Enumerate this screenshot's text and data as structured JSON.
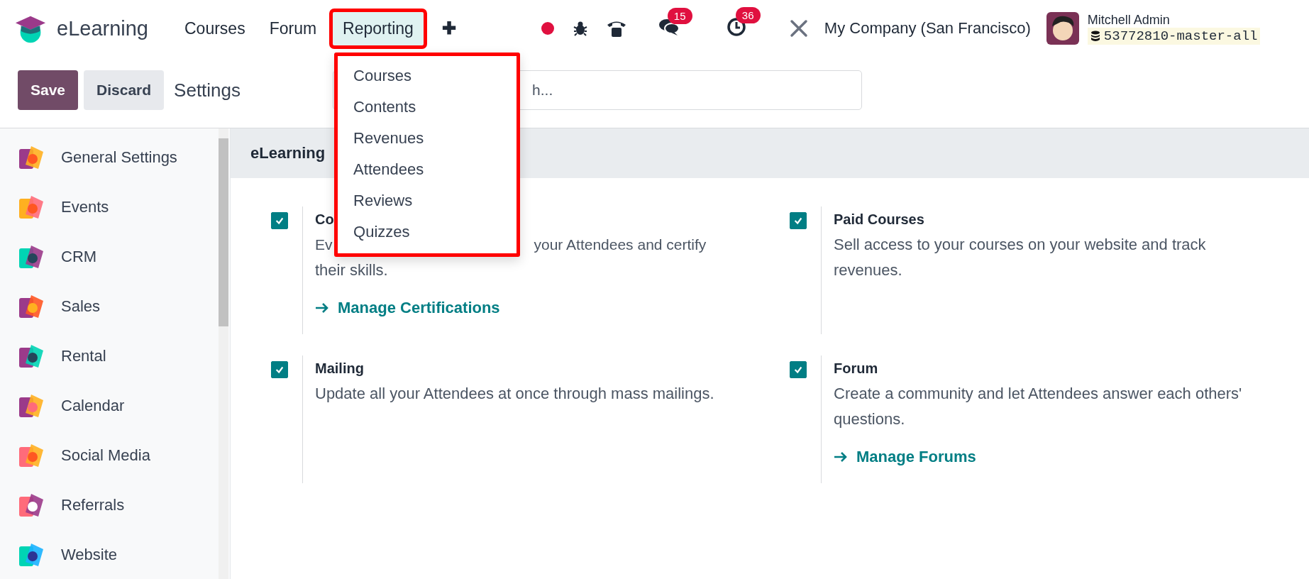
{
  "app": {
    "name": "eLearning"
  },
  "nav": [
    {
      "label": "Courses",
      "selected": false
    },
    {
      "label": "Forum",
      "selected": false
    },
    {
      "label": "Reporting",
      "selected": true
    }
  ],
  "plus": "✚",
  "systray": {
    "messages_count": "15",
    "activities_count": "36",
    "company": "My Company (San Francisco)",
    "user": "Mitchell Admin",
    "database": "53772810-master-all"
  },
  "reporting_menu": [
    {
      "label": "Courses"
    },
    {
      "label": "Contents"
    },
    {
      "label": "Revenues"
    },
    {
      "label": "Attendees"
    },
    {
      "label": "Reviews"
    },
    {
      "label": "Quizzes"
    }
  ],
  "control_bar": {
    "save": "Save",
    "discard": "Discard",
    "title": "Settings",
    "search_placeholder": "h..."
  },
  "sidebar": {
    "items": [
      {
        "label": "General Settings",
        "selected": false
      },
      {
        "label": "Events",
        "selected": false
      },
      {
        "label": "CRM",
        "selected": false
      },
      {
        "label": "Sales",
        "selected": false
      },
      {
        "label": "Rental",
        "selected": false
      },
      {
        "label": "Calendar",
        "selected": false
      },
      {
        "label": "Social Media",
        "selected": false
      },
      {
        "label": "Referrals",
        "selected": false
      },
      {
        "label": "Website",
        "selected": false
      }
    ]
  },
  "section": {
    "title": "eLearning",
    "settings": [
      {
        "kind": "covered",
        "title": "Co",
        "description_parts": [
          "Ev",
          "your Attendees and certify"
        ],
        "description_end": "their skills.",
        "checked": true,
        "link": "Manage Certifications"
      },
      {
        "kind": "normal",
        "title": "Paid Courses",
        "description": "Sell access to your courses on your website and track revenues.",
        "checked": true
      },
      {
        "kind": "normal",
        "title": "Mailing",
        "description": "Update all your Attendees at once through mass mailings.",
        "checked": true
      },
      {
        "kind": "normal",
        "title": "Forum",
        "description": "Create a community and let Attendees answer each others' questions.",
        "checked": true,
        "link": "Manage Forums"
      }
    ]
  }
}
